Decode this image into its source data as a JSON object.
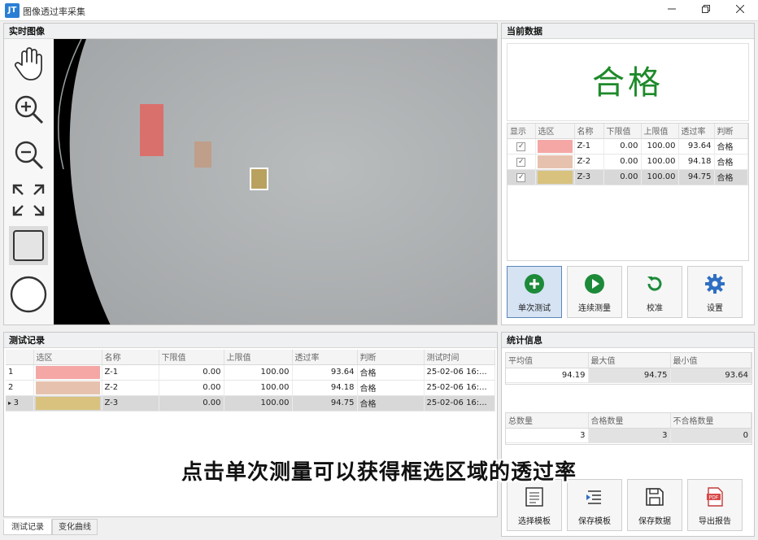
{
  "window": {
    "title": "图像透过率采集",
    "app_icon": "JT"
  },
  "image_panel": {
    "title": "实时图像"
  },
  "current_panel": {
    "title": "当前数据",
    "status": "合格",
    "status_color": "#1d8a2a",
    "columns": [
      "显示",
      "选区",
      "名称",
      "下限值",
      "上限值",
      "透过率",
      "判断"
    ],
    "rows": [
      {
        "show": true,
        "color": "#f4a7a5",
        "name": "Z-1",
        "lower": "0.00",
        "upper": "100.00",
        "rate": "93.64",
        "result": "合格"
      },
      {
        "show": true,
        "color": "#e6c2ae",
        "name": "Z-2",
        "lower": "0.00",
        "upper": "100.00",
        "rate": "94.18",
        "result": "合格"
      },
      {
        "show": true,
        "color": "#d8c27e",
        "name": "Z-3",
        "lower": "0.00",
        "upper": "100.00",
        "rate": "94.75",
        "result": "合格"
      }
    ],
    "buttons": [
      {
        "label": "单次测试",
        "icon": "plus-circle-icon"
      },
      {
        "label": "连续测量",
        "icon": "play-circle-icon"
      },
      {
        "label": "校准",
        "icon": "refresh-icon"
      },
      {
        "label": "设置",
        "icon": "gear-icon"
      }
    ]
  },
  "records_panel": {
    "title": "测试记录",
    "columns": [
      "",
      "选区",
      "名称",
      "下限值",
      "上限值",
      "透过率",
      "判断",
      "测试时间"
    ],
    "rows": [
      {
        "index": "1",
        "color": "#f4a7a5",
        "name": "Z-1",
        "lower": "0.00",
        "upper": "100.00",
        "rate": "93.64",
        "result": "合格",
        "time": "25-02-06 16:..."
      },
      {
        "index": "2",
        "color": "#e6c2ae",
        "name": "Z-2",
        "lower": "0.00",
        "upper": "100.00",
        "rate": "94.18",
        "result": "合格",
        "time": "25-02-06 16:..."
      },
      {
        "index": "3",
        "color": "#d8c27e",
        "name": "Z-3",
        "lower": "0.00",
        "upper": "100.00",
        "rate": "94.75",
        "result": "合格",
        "time": "25-02-06 16:..."
      }
    ]
  },
  "stats_panel": {
    "title": "统计信息",
    "avg_label": "平均值",
    "max_label": "最大值",
    "min_label": "最小值",
    "avg": "94.19",
    "max": "94.75",
    "min": "93.64",
    "total_label": "总数量",
    "pass_label": "合格数量",
    "fail_label": "不合格数量",
    "total": "3",
    "pass": "3",
    "fail": "0",
    "buttons": [
      {
        "label": "选择模板",
        "icon": "template-icon"
      },
      {
        "label": "保存模板",
        "icon": "save-template-icon"
      },
      {
        "label": "保存数据",
        "icon": "floppy-icon"
      },
      {
        "label": "导出报告",
        "icon": "pdf-icon"
      }
    ]
  },
  "tabs": [
    "测试记录",
    "变化曲线"
  ],
  "caption": "点击单次测量可以获得框选区域的透过率"
}
